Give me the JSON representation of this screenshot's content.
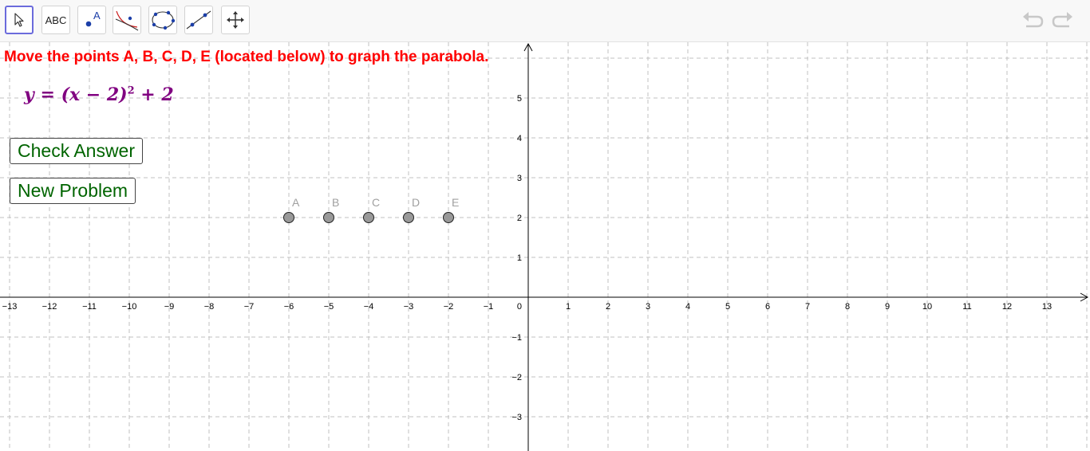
{
  "toolbar": {
    "tools": [
      {
        "name": "move-tool",
        "label": "",
        "selected": true
      },
      {
        "name": "text-tool",
        "label": "ABC"
      },
      {
        "name": "point-tool",
        "label": "A"
      },
      {
        "name": "function-inspector-tool",
        "label": ""
      },
      {
        "name": "conic-through-five-points-tool",
        "label": ""
      },
      {
        "name": "line-tool",
        "label": ""
      },
      {
        "name": "move-graphics-view-tool",
        "label": ""
      }
    ]
  },
  "instruction": "Move the points A, B, C, D, E (located below) to graph the parabola.",
  "equation": {
    "lhs": "y",
    "eq": "=",
    "open": "(x − 2)",
    "exp": "2",
    "tail": "+ 2"
  },
  "buttons": {
    "check": "Check Answer",
    "new": "New Problem"
  },
  "axes": {
    "x_range": [
      -13,
      13
    ],
    "y_range": [
      -3,
      5
    ],
    "x_ticks": [
      "−13",
      "−12",
      "−11",
      "−10",
      "−9",
      "−8",
      "−7",
      "−6",
      "−5",
      "−4",
      "−3",
      "−2",
      "−1",
      "1",
      "2",
      "3",
      "4",
      "5",
      "6",
      "7",
      "8",
      "9",
      "10",
      "11",
      "12",
      "13"
    ],
    "x_tick_values": [
      -13,
      -12,
      -11,
      -10,
      -9,
      -8,
      -7,
      -6,
      -5,
      -4,
      -3,
      -2,
      -1,
      1,
      2,
      3,
      4,
      5,
      6,
      7,
      8,
      9,
      10,
      11,
      12,
      13
    ],
    "y_ticks": [
      "5",
      "4",
      "3",
      "2",
      "1",
      "−1",
      "−2",
      "−3"
    ],
    "y_tick_values": [
      5,
      4,
      3,
      2,
      1,
      -1,
      -2,
      -3
    ],
    "origin_label": "0",
    "grid": true
  },
  "points": [
    {
      "label": "A",
      "x": -6,
      "y": 2
    },
    {
      "label": "B",
      "x": -5,
      "y": 2
    },
    {
      "label": "C",
      "x": -4,
      "y": 2
    },
    {
      "label": "D",
      "x": -3,
      "y": 2
    },
    {
      "label": "E",
      "x": -2,
      "y": 2
    }
  ],
  "colors": {
    "instruction": "#ff0000",
    "equation": "#800080",
    "button_text": "#006400",
    "point_fill": "#999999",
    "point_label": "#a0a0a0",
    "grid": "#c0c0c0",
    "selected_tool": "#6b6bdc"
  }
}
